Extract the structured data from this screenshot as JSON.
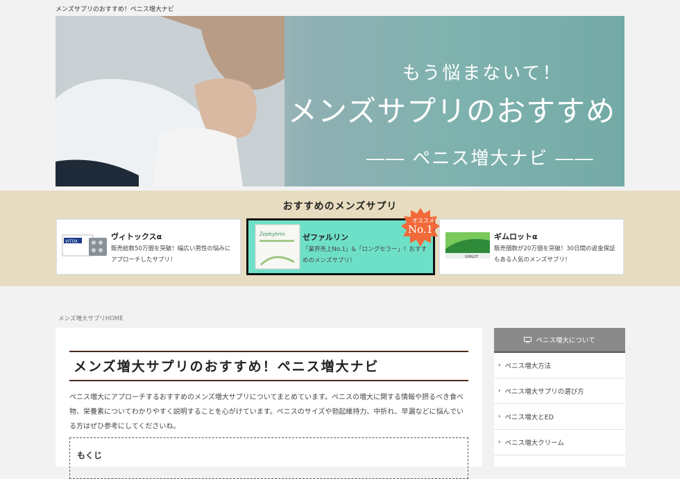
{
  "site": {
    "title": "メンズサプリのおすすめ！ペニス増大ナビ"
  },
  "hero": {
    "line1": "もう悩まないて！",
    "line2": "メンズサプリのおすすめ",
    "line3": "―― ペニス増大ナビ ――"
  },
  "recommend": {
    "title": "おすすめのメンズサプリ",
    "cards": [
      {
        "name": "ヴィトックスα",
        "desc": "販売総数50万個を突破！幅広い男性の悩みにアプローチしたサプリ！",
        "thumb_label": "VITOX"
      },
      {
        "name": "ゼファルリン",
        "desc": "「業界売上No.1」&「ロングセラー」！おすすめのメンズサプリ！",
        "thumb_label": "Zephyhrin"
      },
      {
        "name": "ギムロットα",
        "desc": "販売個数が20万個を突破！30日間の返金保証もある人気のメンズサプリ！",
        "thumb_label": "GIMLOT"
      }
    ],
    "badge": {
      "top": "オススメ",
      "main": "No.1"
    }
  },
  "breadcrumb": {
    "home": "メンズ増大サプリHOME"
  },
  "article": {
    "title": "メンズ増大サプリのおすすめ！ペニス増大ナビ",
    "body": "ペニス増大にアプローチするおすすめのメンズ増大サプリについてまとめています。ペニスの増大に関する情報や摂るべき食べ物、栄養素についてわかりやすく説明することを心がけています。ペニスのサイズや勃起維持力、中折れ、早漏などに悩んでいる方はぜひ参考にしてくださいね。",
    "toc_title": "もくじ"
  },
  "sidebar": {
    "heading": "ペニス増大について",
    "items": [
      "ペニス増大方法",
      "ペニス増大サプリの選び方",
      "ペニス増大とED",
      "ペニス増大クリーム"
    ]
  },
  "colors": {
    "band": "#e7dcbf",
    "featured_card": "#6fe0c8",
    "badge": "#f26a3a",
    "title_rule": "#4a2a1a",
    "sidebar_head": "#8a8a8a"
  }
}
